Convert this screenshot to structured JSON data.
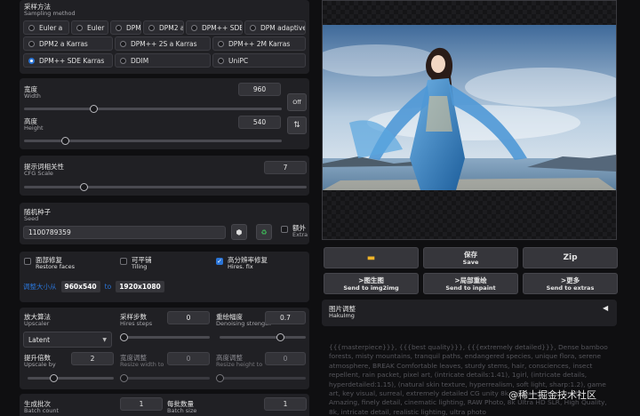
{
  "sampling": {
    "label_zh": "采样方法",
    "label_en": "Sampling method",
    "options": [
      "Euler a",
      "Euler",
      "DPM2",
      "DPM2 a",
      "DPM++ SDE",
      "DPM adaptive",
      "DPM2 a Karras",
      "DPM++ 2S a Karras",
      "DPM++ 2M Karras",
      "DPM++ SDE Karras",
      "DDIM",
      "UniPC"
    ],
    "selected": "DPM++ SDE Karras"
  },
  "width": {
    "label_zh": "宽度",
    "label_en": "Width",
    "value": "960",
    "fraction": 0.27
  },
  "height": {
    "label_zh": "高度",
    "label_en": "Height",
    "value": "540",
    "fraction": 0.16
  },
  "off_button": "Off",
  "swap_icon": "swap-arrows-icon",
  "cfg": {
    "label_zh": "提示词相关性",
    "label_en": "CFG Scale",
    "value": "7",
    "fraction": 0.21
  },
  "seed": {
    "label_zh": "随机种子",
    "label_en": "Seed",
    "value": "1100789359",
    "extra_zh": "额外",
    "extra_en": "Extra"
  },
  "seed_buttons": [
    "dice-icon",
    "recycle-icon"
  ],
  "options": {
    "restore_zh": "面部修复",
    "restore_en": "Restore faces",
    "restore_checked": false,
    "tiling_zh": "可平铺",
    "tiling_en": "Tiling",
    "tiling_checked": false,
    "hires_zh": "高分辨率修复",
    "hires_en": "Hires. fix",
    "hires_checked": true
  },
  "resize_info": {
    "text": "调整大小从",
    "from": "960x540",
    "to_word": "to",
    "to": "1920x1080"
  },
  "upscaler": {
    "label_zh": "放大算法",
    "label_en": "Upscaler",
    "value": "Latent"
  },
  "hires_steps": {
    "label_zh": "采样步数",
    "label_en": "Hires steps",
    "value": "0",
    "fraction": 0.0
  },
  "denoising": {
    "label_zh": "重绘幅度",
    "label_en": "Denoising strength",
    "value": "0.7",
    "fraction": 0.7
  },
  "upscale_by": {
    "label_zh": "提升倍数",
    "label_en": "Upscale by",
    "value": "2",
    "fraction": 0.3
  },
  "resize_width": {
    "label_zh": "宽度调整",
    "label_en": "Resize width to",
    "value": "0",
    "fraction": 0.0
  },
  "resize_height": {
    "label_zh": "高度调整",
    "label_en": "Resize height to",
    "value": "0",
    "fraction": 0.0
  },
  "batch_count": {
    "label_zh": "生成批次",
    "label_en": "Batch count",
    "value": "1"
  },
  "batch_size": {
    "label_zh": "每批数量",
    "label_en": "Batch size",
    "value": "1"
  },
  "actions": {
    "folder_icon": "folder-icon",
    "save_zh": "保存",
    "save_en": "Save",
    "zip": "Zip",
    "img2img_zh": ">图生图",
    "img2img_en": "Send to img2img",
    "inpaint_zh": ">局部重绘",
    "inpaint_en": "Send to inpaint",
    "extras_zh": ">更多",
    "extras_en": "Send to extras"
  },
  "hakuimg": {
    "label_zh": "图片调整",
    "label_en": "HakuImg"
  },
  "prompt_text": "{{{masterpiece}}}, {{{best quality}}}, {{{extremely detailed}}}, Dense bamboo forests, misty mountains, tranquil paths, endangered species, unique flora, serene atmosphere, BREAK Comfortable leaves, sturdy stems, hair, consciences, insect repellent, rain packet, pixel art, (intricate details:1.41), 1girl, (intricate details, hyperdetailed:1.15), (natural skin texture, hyperrealism, soft light, sharp:1.2), game art, key visual, surreal, extremely detailed CG unity 8k wallpaper, best quality, Amazing, finely detail, cinematic lighting, RAW Photo, 8k Ultra HD SLR, High Quality, 8k, intricate detail, realistic lighting, ultra photo",
  "watermark": "@稀土掘金技术社区"
}
